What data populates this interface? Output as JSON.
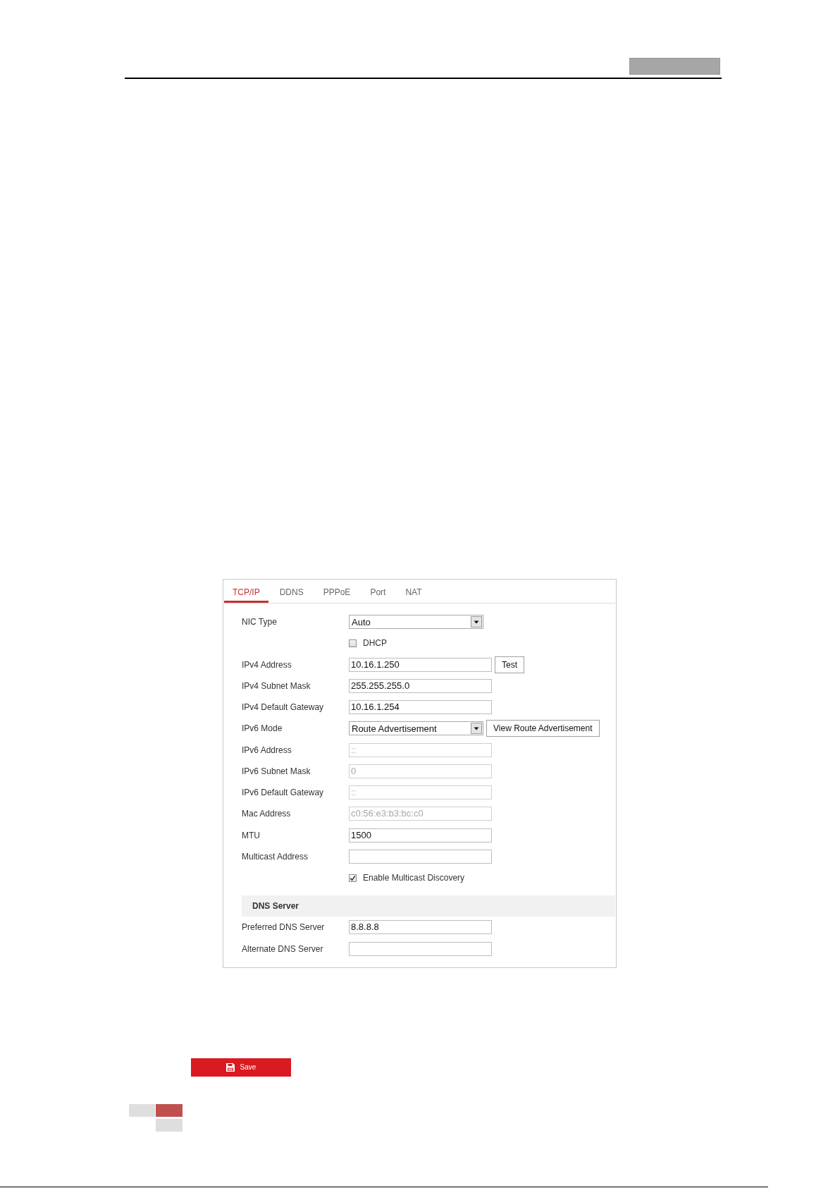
{
  "tabs": [
    {
      "label": "TCP/IP",
      "selected": true
    },
    {
      "label": "DDNS",
      "selected": false
    },
    {
      "label": "PPPoE",
      "selected": false
    },
    {
      "label": "Port",
      "selected": false
    },
    {
      "label": "NAT",
      "selected": false
    }
  ],
  "fields": [
    {
      "kind": "select",
      "label": "NIC Type",
      "value": "Auto"
    },
    {
      "kind": "checkbox",
      "label": "DHCP",
      "checked": false
    },
    {
      "kind": "text",
      "label": "IPv4 Address",
      "value": "10.16.1.250",
      "disabled": false,
      "button": "Test"
    },
    {
      "kind": "text",
      "label": "IPv4 Subnet Mask",
      "value": "255.255.255.0",
      "disabled": false
    },
    {
      "kind": "text",
      "label": "IPv4 Default Gateway",
      "value": "10.16.1.254",
      "disabled": false
    },
    {
      "kind": "select",
      "label": "IPv6 Mode",
      "value": "Route Advertisement",
      "button": "View Route Advertisement"
    },
    {
      "kind": "text",
      "label": "IPv6 Address",
      "value": "::",
      "disabled": true
    },
    {
      "kind": "text",
      "label": "IPv6 Subnet Mask",
      "value": "0",
      "disabled": true
    },
    {
      "kind": "text",
      "label": "IPv6 Default Gateway",
      "value": "::",
      "disabled": true
    },
    {
      "kind": "text",
      "label": "Mac Address",
      "value": "c0:56:e3:b3:bc:c0",
      "disabled": true
    },
    {
      "kind": "text",
      "label": "MTU",
      "value": "1500",
      "disabled": false
    },
    {
      "kind": "text",
      "label": "Multicast Address"
    },
    {
      "kind": "checkbox",
      "label": "Enable Multicast Discovery",
      "checked": true
    }
  ],
  "dns_server": {
    "title": "DNS Server",
    "fields": [
      {
        "kind": "text",
        "label": "Preferred DNS Server",
        "value": "8.8.8.8",
        "disabled": false
      },
      {
        "kind": "text",
        "label": "Alternate DNS Server"
      }
    ]
  },
  "save_button": {
    "label": "Save"
  }
}
